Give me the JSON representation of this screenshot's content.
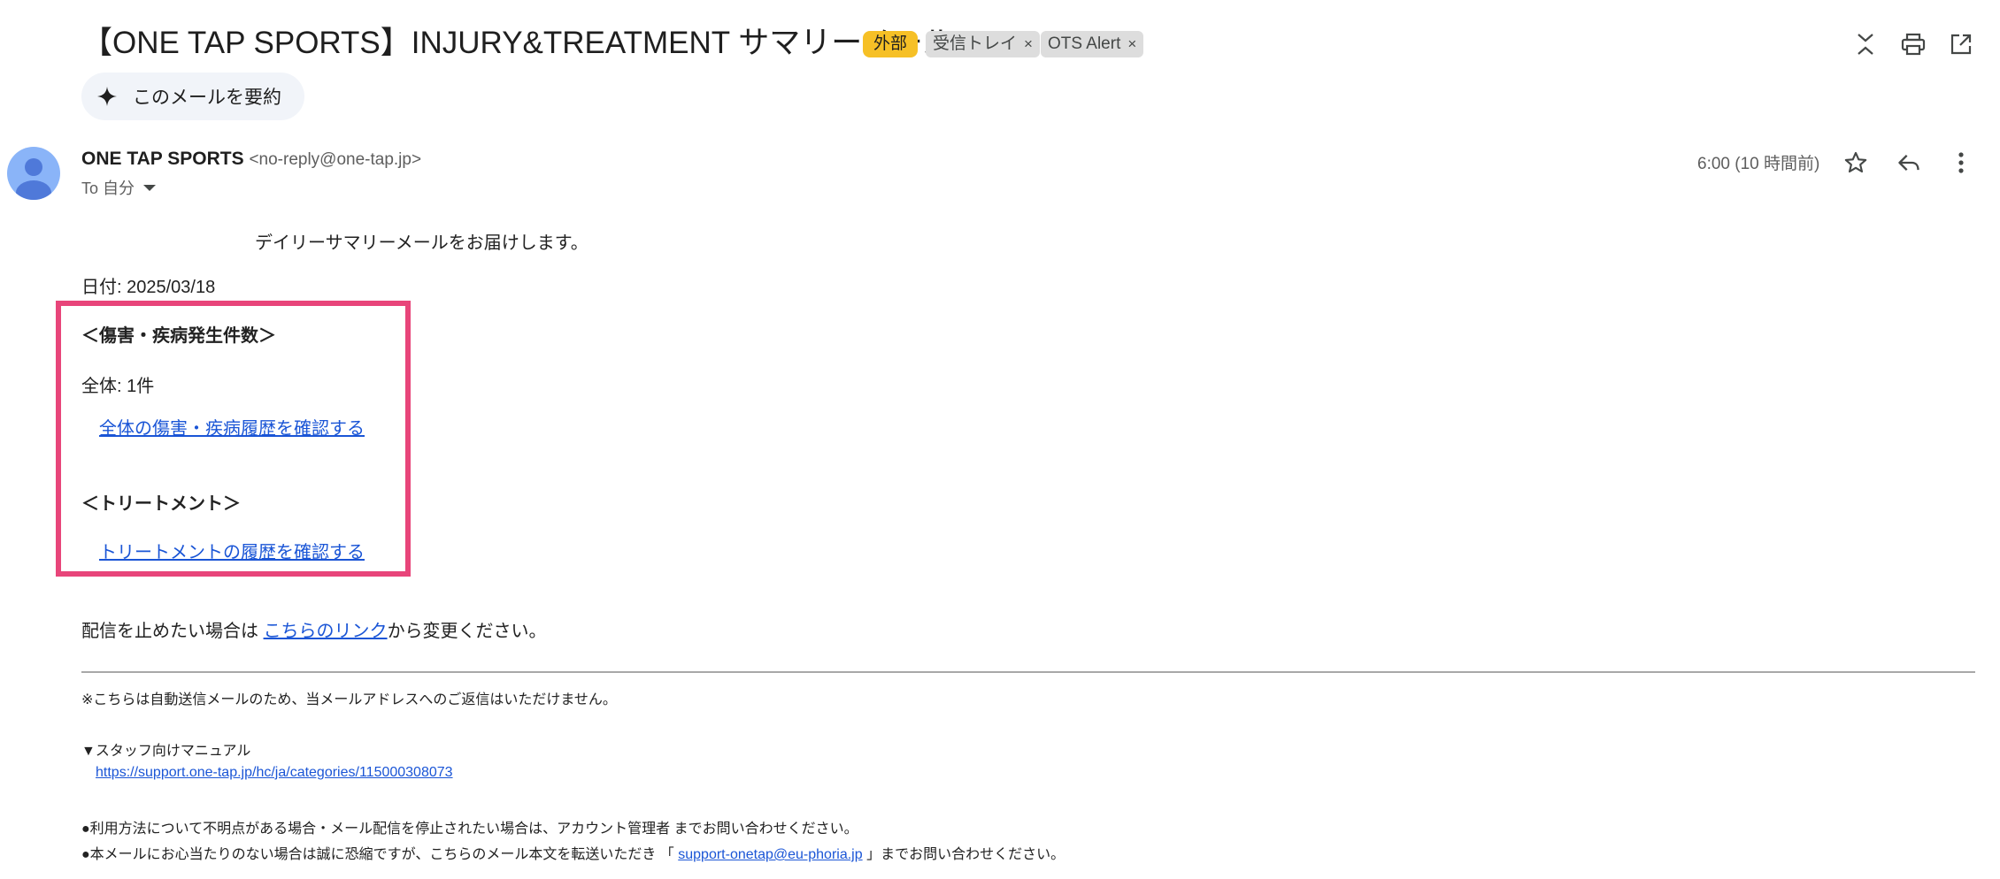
{
  "header": {
    "subject": "【ONE TAP SPORTS】INJURY&TREATMENT サマリーメール",
    "external_badge": "外部",
    "labels": [
      {
        "name": "受信トレイ",
        "remove": "×"
      },
      {
        "name": "OTS Alert",
        "remove": "×"
      }
    ],
    "icons": [
      "collapse-all-icon",
      "print-icon",
      "open-new-window-icon"
    ],
    "summarize_button": "このメールを要約"
  },
  "message": {
    "sender_name": "ONE TAP SPORTS",
    "sender_address": "<no-reply@one-tap.jp>",
    "to_line": "To 自分",
    "time": "6:00 (10 時間前)",
    "icons": [
      "star-icon",
      "reply-icon",
      "more-vert-icon"
    ]
  },
  "body": {
    "intro": "デイリーサマリーメールをお届けします。",
    "date_line": "日付: 2025/03/18",
    "injury_heading": "＜傷害・疾病発生件数＞",
    "injury_total": "全体: 1件",
    "injury_link": "全体の傷害・疾病履歴を確認する",
    "treatment_heading": "＜トリートメント＞",
    "treatment_link": "トリートメントの履歴を確認する",
    "unsubscribe_prefix": "配信を止めたい場合は ",
    "unsubscribe_link": "こちらのリンク",
    "unsubscribe_suffix": "から変更ください。"
  },
  "footer": {
    "notice": "※こちらは自動送信メールのため、当メールアドレスへのご返信はいただけません。",
    "manual_heading": "▼スタッフ向けマニュアル",
    "manual_url": "https://support.one-tap.jp/hc/ja/categories/115000308073",
    "contact_line": "●利用方法について不明点がある場合・メール配信を停止されたい場合は、アカウント管理者 までお問い合わせください。",
    "forward_prefix": "●本メールにお心当たりのない場合は誠に恐縮ですが、こちらのメール本文を転送いただき 「 ",
    "support_email": "support-onetap@eu-phoria.jp",
    "forward_suffix": " 」までお問い合わせください。"
  },
  "colors": {
    "external_badge": "#f6c026",
    "highlight_box": "#e8457a",
    "link": "#1a55d6",
    "avatar": "#8ab4f8"
  }
}
